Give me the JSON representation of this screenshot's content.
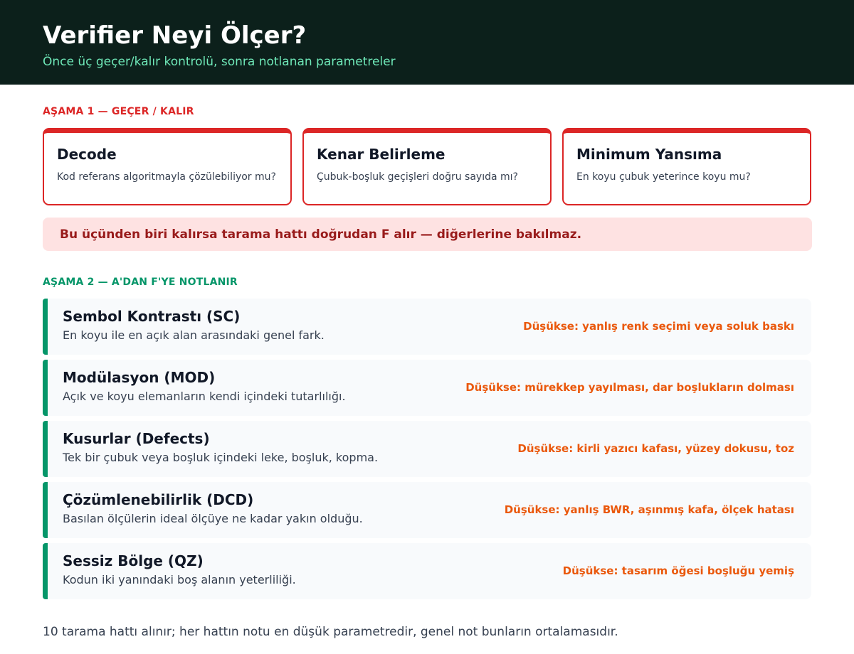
{
  "header": {
    "title": "Verifier Neyi Ölçer?",
    "subtitle": "Önce üç geçer/kalır kontrolü, sonra notlanan parametreler"
  },
  "stage1": {
    "label": "AŞAMA 1 — GEÇER / KALIR",
    "cards": [
      {
        "title": "Decode",
        "desc": "Kod referans algoritmayla çözülebiliyor mu?"
      },
      {
        "title": "Kenar Belirleme",
        "desc": "Çubuk-boşluk geçişleri doğru sayıda mı?"
      },
      {
        "title": "Minimum Yansıma",
        "desc": "En koyu çubuk yeterince koyu mu?"
      }
    ],
    "warning": "Bu üçünden biri kalırsa tarama hattı doğrudan F alır — diğerlerine bakılmaz."
  },
  "stage2": {
    "label": "AŞAMA 2 — A'DAN F'YE NOTLANIR",
    "params": [
      {
        "title": "Sembol Kontrastı (SC)",
        "desc": "En koyu ile en açık alan arasındaki genel fark.",
        "issue": "Düşükse: yanlış renk seçimi veya soluk baskı"
      },
      {
        "title": "Modülasyon (MOD)",
        "desc": "Açık ve koyu elemanların kendi içindeki tutarlılığı.",
        "issue": "Düşükse: mürekkep yayılması, dar boşlukların dolması"
      },
      {
        "title": "Kusurlar (Defects)",
        "desc": "Tek bir çubuk veya boşluk içindeki leke, boşluk, kopma.",
        "issue": "Düşükse: kirli yazıcı kafası, yüzey dokusu, toz"
      },
      {
        "title": "Çözümlenebilirlik (DCD)",
        "desc": "Basılan ölçülerin ideal ölçüye ne kadar yakın olduğu.",
        "issue": "Düşükse: yanlış BWR, aşınmış kafa, ölçek hatası"
      },
      {
        "title": "Sessiz Bölge (QZ)",
        "desc": "Kodun iki yanındaki boş alanın yeterliliği.",
        "issue": "Düşükse: tasarım öğesi boşluğu yemiş"
      }
    ]
  },
  "footer": "10 tarama hattı alınır; her hattın notu en düşük parametredir, genel not bunların ortalamasıdır."
}
